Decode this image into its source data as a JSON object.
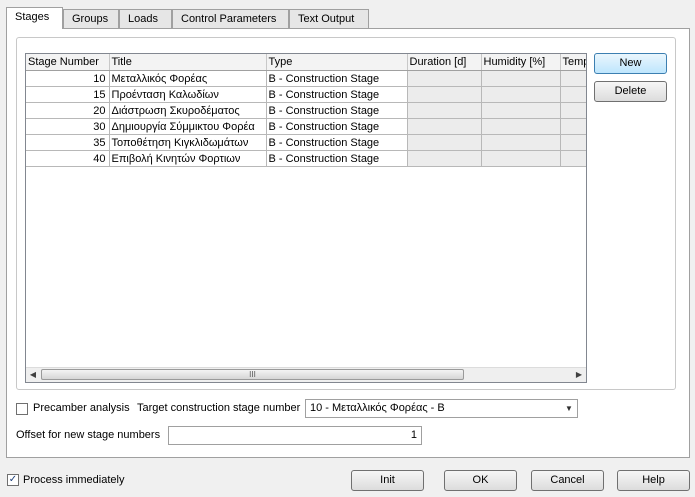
{
  "tabs": [
    {
      "label": "Stages",
      "active": true
    },
    {
      "label": "Groups"
    },
    {
      "label": "Loads"
    },
    {
      "label": "Control Parameters"
    },
    {
      "label": "Text Output"
    }
  ],
  "grid": {
    "columns": [
      "Stage Number",
      "Title",
      "Type",
      "Duration [d]",
      "Humidity [%]",
      "Temp"
    ],
    "rows": [
      {
        "number": "10",
        "title": "Μεταλλικός Φορέας",
        "type": "B - Construction Stage"
      },
      {
        "number": "15",
        "title": "Προένταση Καλωδίων",
        "type": "B - Construction Stage"
      },
      {
        "number": "20",
        "title": "Διάστρωση Σκυροδέματος",
        "type": "B - Construction Stage"
      },
      {
        "number": "30",
        "title": "Δημιουργία Σύμμικτου Φορέα",
        "type": "B - Construction Stage"
      },
      {
        "number": "35",
        "title": "Τοποθέτηση Κιγκλιδωμάτων",
        "type": "B - Construction Stage"
      },
      {
        "number": "40",
        "title": "Επιβολή Κινητών Φορτιων",
        "type": "B - Construction Stage"
      }
    ],
    "scroll_thumb_glyph": "III"
  },
  "buttons": {
    "new": "New",
    "delete": "Delete",
    "init": "Init",
    "ok": "OK",
    "cancel": "Cancel",
    "help": "Help"
  },
  "precamber": {
    "label": "Precamber analysis",
    "checked": false
  },
  "target_stage": {
    "label": "Target construction stage number",
    "value": "10 - Μεταλλικός Φορέας - B"
  },
  "offset": {
    "label": "Offset for new stage numbers",
    "value": "1"
  },
  "process_immediately": {
    "label": "Process immediately",
    "checked": true,
    "check_glyph": "✓"
  }
}
